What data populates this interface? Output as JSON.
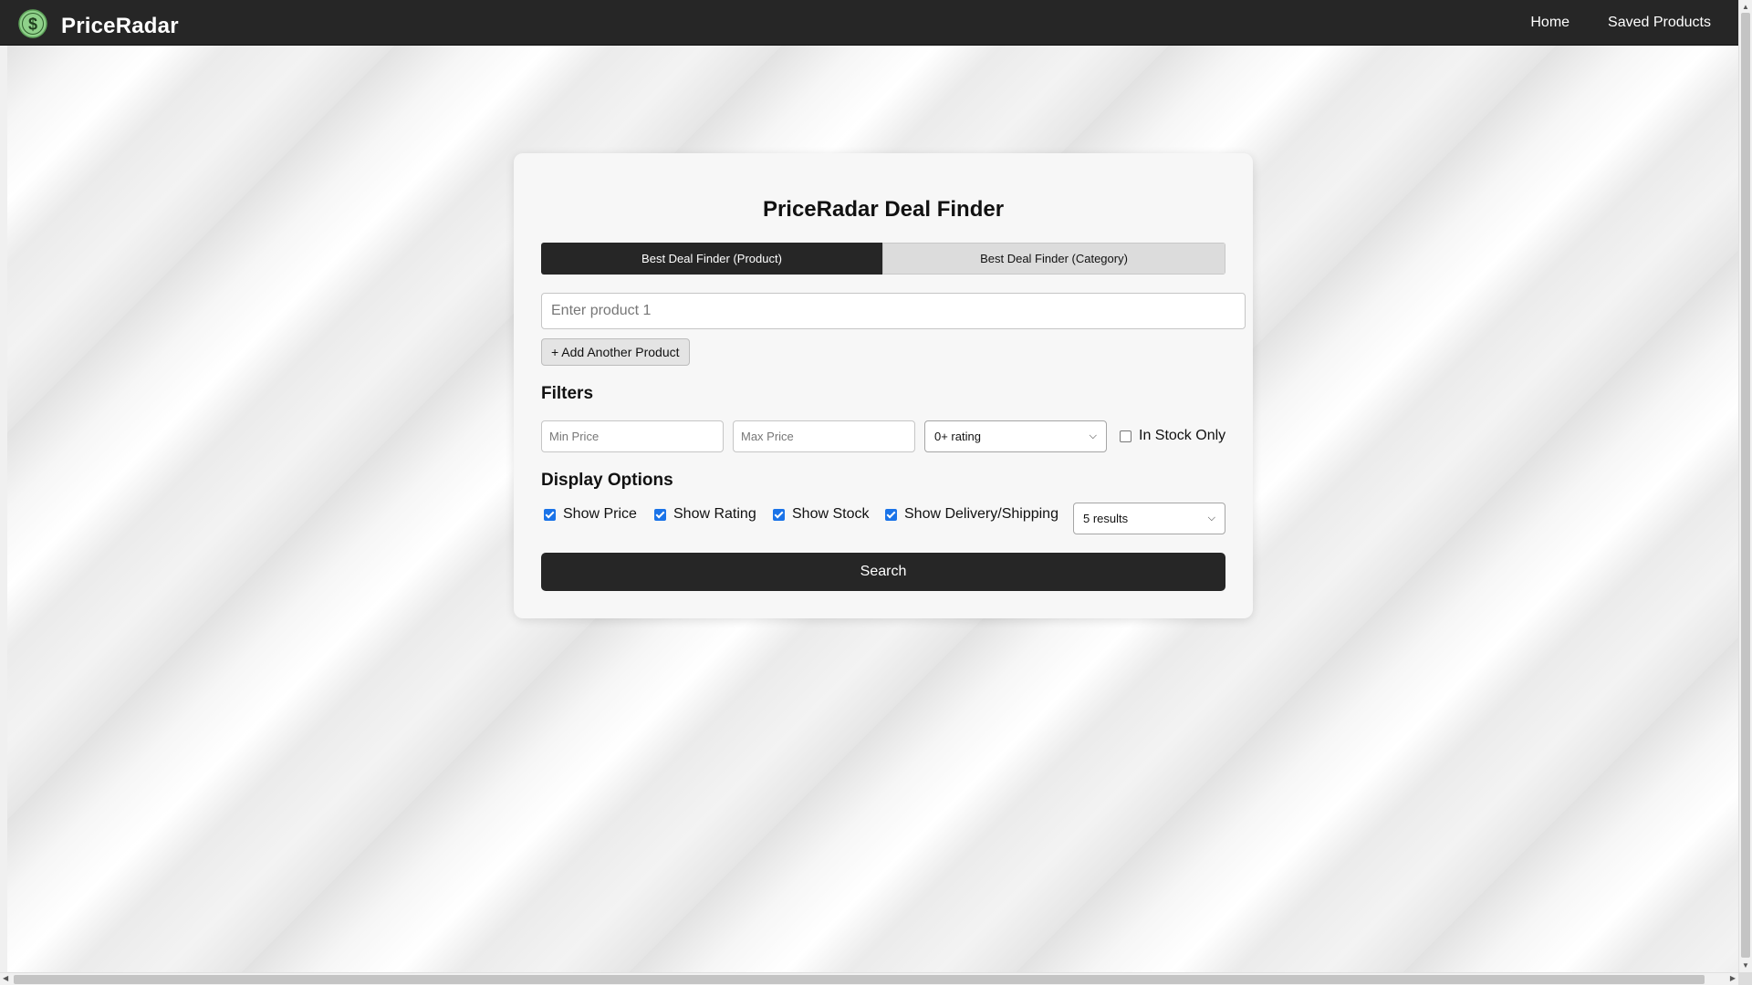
{
  "app": {
    "brand": "PriceRadar",
    "logo_icon": "dollar-coin-icon",
    "nav": [
      {
        "label": "Home"
      },
      {
        "label": "Saved Products"
      }
    ]
  },
  "colors": {
    "navbar": "#262626",
    "accent_logo": "#8fd18a",
    "checkbox": "#1a73e8",
    "primary_button": "#262626"
  },
  "finder": {
    "title": "PriceRadar Deal Finder",
    "tabs": [
      {
        "label": "Best Deal Finder (Product)",
        "active": true
      },
      {
        "label": "Best Deal Finder (Category)",
        "active": false
      }
    ],
    "product_input": {
      "placeholder": "Enter product 1",
      "value": ""
    },
    "add_product_label": "+ Add Another Product",
    "filters": {
      "title": "Filters",
      "min_price_placeholder": "Min Price",
      "max_price_placeholder": "Max Price",
      "rating_selected": "0+ rating",
      "in_stock_label": "In Stock Only",
      "in_stock_checked": false
    },
    "display_options": {
      "title": "Display Options",
      "checks": [
        {
          "label": "Show Price",
          "checked": true
        },
        {
          "label": "Show Rating",
          "checked": true
        },
        {
          "label": "Show Stock",
          "checked": true
        },
        {
          "label": "Show Delivery/Shipping",
          "checked": true
        }
      ],
      "results_selected": "5 results"
    },
    "search_label": "Search"
  }
}
